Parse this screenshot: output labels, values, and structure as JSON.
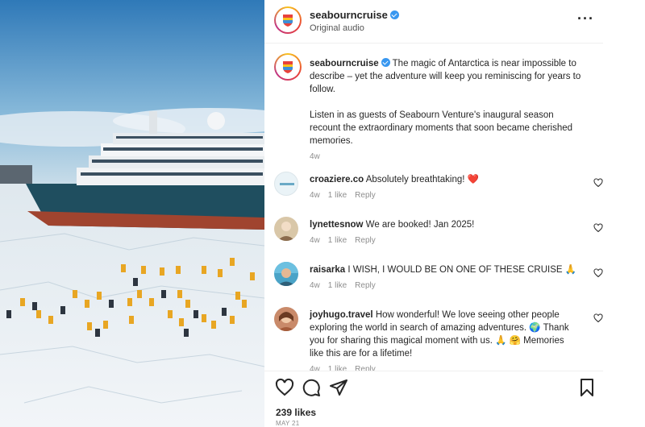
{
  "post": {
    "username": "seabourncruise",
    "audio": "Original audio",
    "more_icon": "more-dots-icon"
  },
  "caption": {
    "username": "seabourncruise",
    "paragraph1": "The magic of Antarctica is near impossible to describe – yet the adventure will keep you reminiscing for years to follow.",
    "paragraph2": "Listen in as guests of Seabourn Venture's inaugural season recount the extraordinary moments that soon became cherished memories.",
    "time": "4w"
  },
  "comments": [
    {
      "username": "croaziere.co",
      "text": "Absolutely breathtaking! ❤️",
      "time": "4w",
      "likes": "1 like",
      "reply": "Reply",
      "avatar_color": "#eaf3f7"
    },
    {
      "username": "lynettesnow",
      "text": "We are booked! Jan 2025!",
      "time": "4w",
      "likes": "1 like",
      "reply": "Reply",
      "avatar_color": "#d9c7a8"
    },
    {
      "username": "raisarka",
      "text": "I WISH, I WOULD BE ON ONE OF THESE CRUISE 🙏",
      "time": "4w",
      "likes": "1 like",
      "reply": "Reply",
      "avatar_color": "#4aa3c7"
    },
    {
      "username": "joyhugo.travel",
      "text": "How wonderful! We love seeing other people exploring the world in search of amazing adventures. 🌍 Thank you for sharing this magical moment with us. 🙏 🤗 Memories like this are for a lifetime!",
      "time": "4w",
      "likes": "1 like",
      "reply": "Reply",
      "avatar_color": "#c98a6a"
    }
  ],
  "actions": {
    "like_icon": "heart-icon",
    "comment_icon": "comment-icon",
    "share_icon": "share-icon",
    "save_icon": "bookmark-icon"
  },
  "likes": "239 likes",
  "date": "MAY 21"
}
